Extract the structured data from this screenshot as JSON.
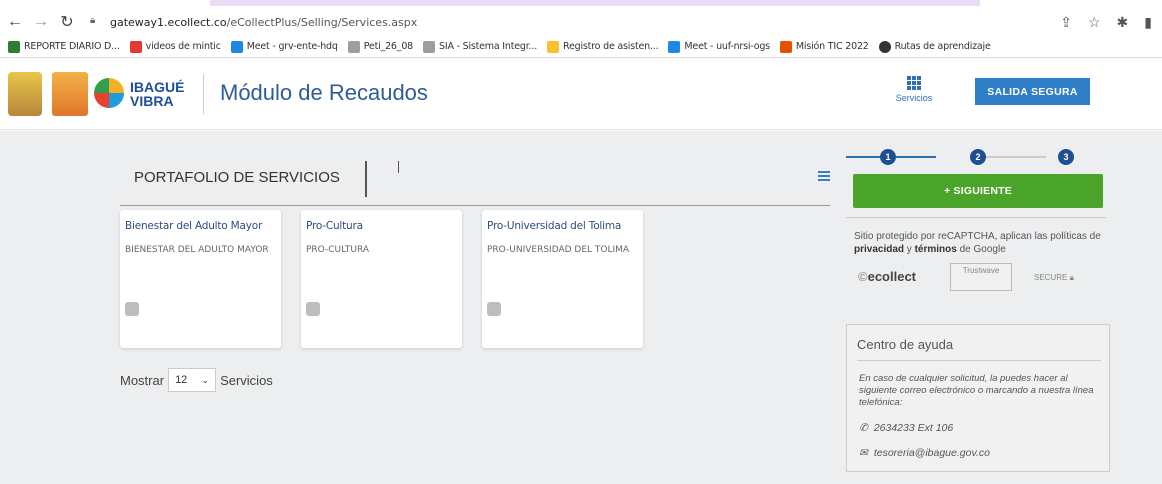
{
  "browser": {
    "url_host": "gateway1.ecollect.co",
    "url_path": "/eCollectPlus/Selling/Services.aspx",
    "bookmarks": [
      {
        "label": "REPORTE DIARIO D...",
        "color": "#2e7d32"
      },
      {
        "label": "videos de mintic",
        "color": "#e53935"
      },
      {
        "label": "Meet - grv-ente-hdq",
        "color": "#1e88e5"
      },
      {
        "label": "Peti_26_08",
        "color": "#9e9e9e"
      },
      {
        "label": "SIA - Sistema Integr...",
        "color": "#9e9e9e"
      },
      {
        "label": "Registro de asisten...",
        "color": "#fbc02d"
      },
      {
        "label": "Meet - uuf-nrsi-ogs",
        "color": "#1e88e5"
      },
      {
        "label": "Misión TIC 2022",
        "color": "#e65100"
      },
      {
        "label": "Rutas de aprendizaje",
        "color": "#333333"
      }
    ]
  },
  "header": {
    "logo_text_line1": "IBAGUÉ",
    "logo_text_line2": "VIBRA",
    "title": "Módulo de Recaudos",
    "services_label": "Servicios",
    "logout_label": "SALIDA SEGURA"
  },
  "portfolio": {
    "title": "PORTAFOLIO DE SERVICIOS",
    "cards": [
      {
        "title": "Bienestar del Adulto Mayor",
        "desc": "BIENESTAR DEL ADULTO MAYOR"
      },
      {
        "title": "Pro-Cultura",
        "desc": "PRO-CULTURA"
      },
      {
        "title": "Pro-Universidad del Tolima",
        "desc": "PRO-UNIVERSIDAD DEL TOLIMA"
      }
    ],
    "show_label": "Mostrar",
    "show_value": "12",
    "show_suffix": "Servicios"
  },
  "steps": [
    "1",
    "2",
    "3"
  ],
  "next_label": "+ SIGUIENTE",
  "captcha": {
    "text_part1": "Sitio protegido por reCAPTCHA, aplican las políticas de ",
    "privacy": "privacidad",
    "and": " y ",
    "terms": "términos",
    "text_part2": " de Google",
    "ecollect_label": "ecollect",
    "trustwave_label": "Trustwave",
    "secure_label": "SECURE"
  },
  "help": {
    "title": "Centro de ayuda",
    "text": "En caso de cualquier solicitud, la puedes hacer al siguiente correo electrónico o marcando a nuestra línea telefónica:",
    "phone": "2634233 Ext 106",
    "email": "tesoreria@ibague.gov.co"
  }
}
